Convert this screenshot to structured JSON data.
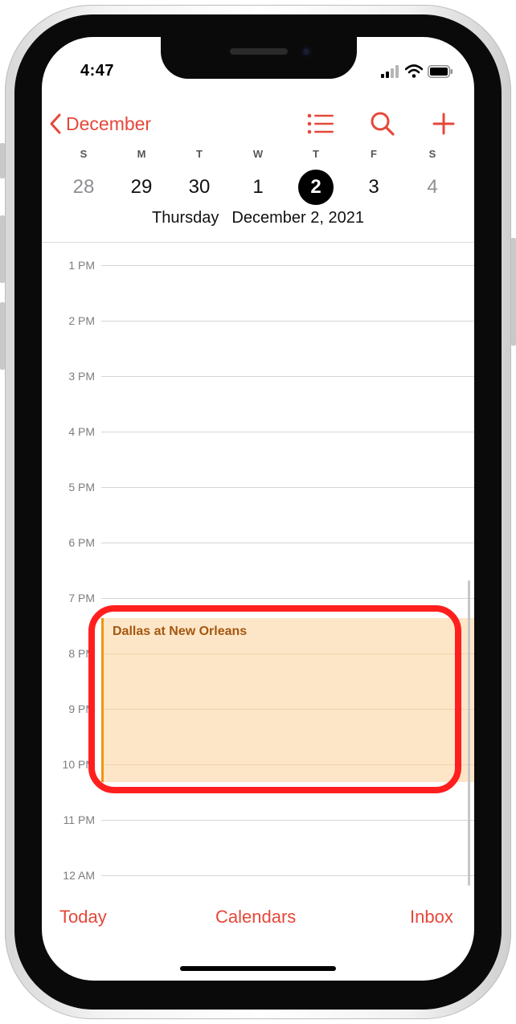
{
  "status_bar": {
    "time": "4:47",
    "icons": [
      "cellular-signal-icon",
      "wifi-icon",
      "battery-icon"
    ]
  },
  "nav": {
    "back_label": "December",
    "back_icon": "chevron-left-icon",
    "actions": [
      "list-icon",
      "search-icon",
      "plus-icon"
    ]
  },
  "week": {
    "day_letters": [
      "S",
      "M",
      "T",
      "W",
      "T",
      "F",
      "S"
    ],
    "dates": [
      "28",
      "29",
      "30",
      "1",
      "2",
      "3",
      "4"
    ],
    "selected_index": 4
  },
  "selected_day": {
    "weekday": "Thursday",
    "date": "December 2, 2021"
  },
  "hours": [
    "1 PM",
    "2 PM",
    "3 PM",
    "4 PM",
    "5 PM",
    "6 PM",
    "7 PM",
    "8 PM",
    "9 PM",
    "10 PM",
    "11 PM",
    "12 AM"
  ],
  "event": {
    "title": "Dallas at New Orleans"
  },
  "tab_bar": {
    "today": "Today",
    "calendars": "Calendars",
    "inbox": "Inbox"
  },
  "colors": {
    "accent": "#e5483a",
    "event_bg": "#fde6c8",
    "event_bar": "#f0960e",
    "event_text": "#a4570f",
    "highlight": "#ff1f1f"
  }
}
